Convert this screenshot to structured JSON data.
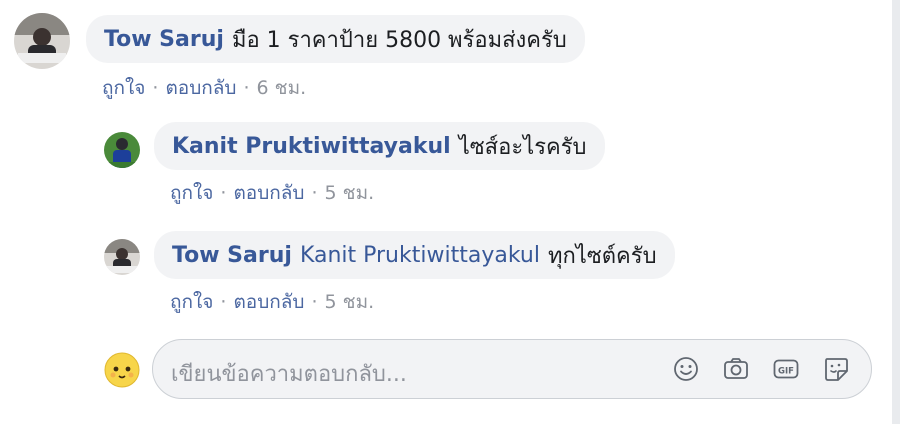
{
  "comments": [
    {
      "author": "Tow Saruj",
      "mention": "",
      "text": "มือ 1 ราคาป้าย 5800 พร้อมส่งครับ",
      "like": "ถูกใจ",
      "sep": "·",
      "reply": "ตอบกลับ",
      "time": "6 ชม."
    },
    {
      "author": "Kanit Pruktiwittayakul",
      "mention": "",
      "text": "ไซส์อะไรครับ",
      "like": "ถูกใจ",
      "sep": "·",
      "reply": "ตอบกลับ",
      "time": "5 ชม."
    },
    {
      "author": "Tow Saruj",
      "mention": "Kanit Pruktiwittayakul",
      "text": "ทุกไซต์ครับ",
      "like": "ถูกใจ",
      "sep": "·",
      "reply": "ตอบกลับ",
      "time": "5 ชม."
    }
  ],
  "reply_box": {
    "placeholder": "เขียนข้อความตอบกลับ...",
    "icons": [
      "emoji-icon",
      "camera-icon",
      "gif-icon",
      "sticker-icon"
    ]
  },
  "colors": {
    "link": "#385898",
    "bubble": "#f2f3f5",
    "meta": "#90949c"
  }
}
